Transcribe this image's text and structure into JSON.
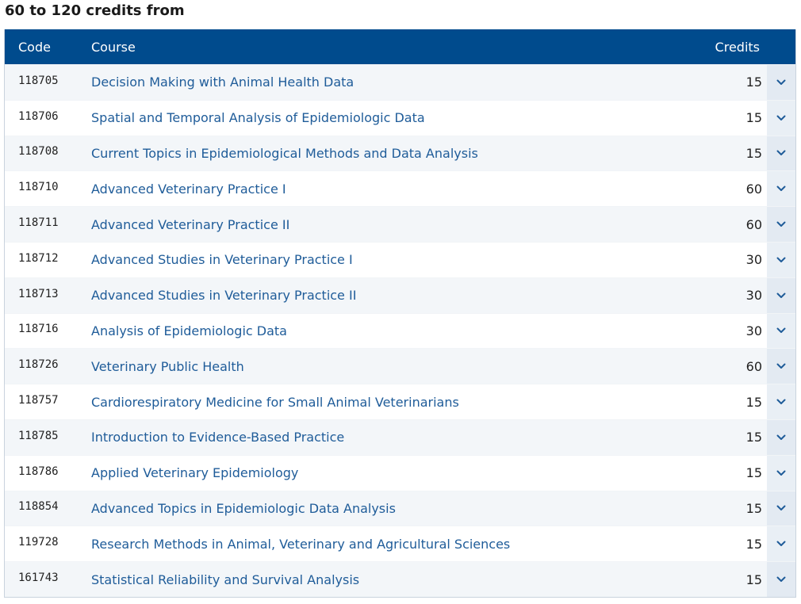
{
  "heading": "60 to 120 credits from",
  "table": {
    "headers": {
      "code": "Code",
      "course": "Course",
      "credits": "Credits"
    },
    "rows": [
      {
        "code": "118705",
        "course": "Decision Making with Animal Health Data",
        "credits": "15"
      },
      {
        "code": "118706",
        "course": "Spatial and Temporal Analysis of Epidemiologic Data",
        "credits": "15"
      },
      {
        "code": "118708",
        "course": "Current Topics in Epidemiological Methods and Data Analysis",
        "credits": "15"
      },
      {
        "code": "118710",
        "course": "Advanced Veterinary Practice I",
        "credits": "60"
      },
      {
        "code": "118711",
        "course": "Advanced Veterinary Practice II",
        "credits": "60"
      },
      {
        "code": "118712",
        "course": "Advanced Studies in Veterinary Practice I",
        "credits": "30"
      },
      {
        "code": "118713",
        "course": "Advanced Studies in Veterinary Practice II",
        "credits": "30"
      },
      {
        "code": "118716",
        "course": "Analysis of Epidemiologic Data",
        "credits": "30"
      },
      {
        "code": "118726",
        "course": "Veterinary Public Health",
        "credits": "60"
      },
      {
        "code": "118757",
        "course": "Cardiorespiratory Medicine for Small Animal Veterinarians",
        "credits": "15"
      },
      {
        "code": "118785",
        "course": "Introduction to Evidence-Based Practice",
        "credits": "15"
      },
      {
        "code": "118786",
        "course": "Applied Veterinary Epidemiology",
        "credits": "15"
      },
      {
        "code": "118854",
        "course": "Advanced Topics in Epidemiologic Data Analysis",
        "credits": "15"
      },
      {
        "code": "119728",
        "course": "Research Methods in Animal, Veterinary and Agricultural Sciences",
        "credits": "15"
      },
      {
        "code": "161743",
        "course": "Statistical Reliability and Survival Analysis",
        "credits": "15"
      }
    ]
  },
  "icons": {
    "expand": "chevron-down-icon"
  },
  "colors": {
    "header_bg": "#004b8d",
    "link": "#1f5c99",
    "toggle_bg": "#e3eaf2"
  }
}
